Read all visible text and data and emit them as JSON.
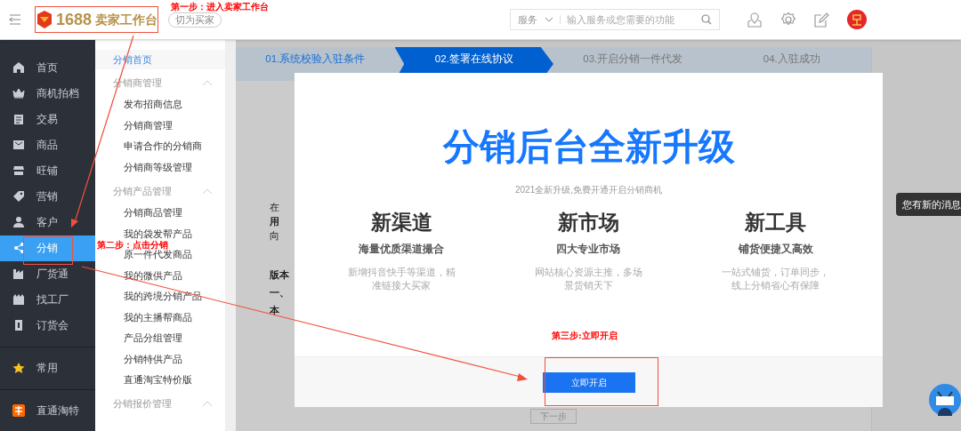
{
  "header": {
    "brand_number": "1688",
    "brand_name": "卖家工作台",
    "switch_button": "切为买家",
    "search": {
      "scope": "服务",
      "placeholder": "输入服务或您需要的功能"
    }
  },
  "nav": [
    {
      "label": "首页",
      "selected": false
    },
    {
      "label": "商机拍档",
      "selected": false
    },
    {
      "label": "交易",
      "selected": false
    },
    {
      "label": "商品",
      "selected": false
    },
    {
      "label": "旺铺",
      "selected": false
    },
    {
      "label": "营销",
      "selected": false
    },
    {
      "label": "客户",
      "selected": false
    },
    {
      "label": "分销",
      "selected": true
    },
    {
      "label": "厂货通",
      "selected": false
    },
    {
      "label": "找工厂",
      "selected": false
    },
    {
      "label": "订货会",
      "selected": false
    },
    {
      "label": "常用",
      "selected": false,
      "divider_before": true
    },
    {
      "label": "直通淘特",
      "selected": false,
      "divider_before": true
    }
  ],
  "submenu": [
    {
      "kind": "link",
      "label": "分销首页",
      "selected": true
    },
    {
      "kind": "group",
      "label": "分销商管理",
      "expanded": true,
      "children": [
        {
          "label": "发布招商信息"
        },
        {
          "label": "分销商管理"
        },
        {
          "label": "申请合作的分销商"
        },
        {
          "label": "分销商等级管理"
        }
      ]
    },
    {
      "kind": "group",
      "label": "分销产品管理",
      "expanded": true,
      "children": [
        {
          "label": "分销商品管理"
        },
        {
          "label": "我的袋发帮产品"
        },
        {
          "label": "原一件代发商品"
        },
        {
          "label": "我的微供产品"
        },
        {
          "label": "我的跨境分销产品"
        },
        {
          "label": "我的主播帮商品"
        },
        {
          "label": "产品分组管理"
        },
        {
          "label": "分销特供产品"
        },
        {
          "label": "直通淘宝特价版"
        }
      ]
    },
    {
      "kind": "group",
      "label": "分销报价管理",
      "expanded": true
    }
  ],
  "steps": [
    {
      "label": "01.系统校验入驻条件",
      "selected": false,
      "done": true
    },
    {
      "label": "02.签署在线协议",
      "selected": true,
      "done": false
    },
    {
      "label": "03.开启分销一件代发",
      "selected": false,
      "done": false
    },
    {
      "label": "04.入驻成功",
      "selected": false,
      "done": false
    }
  ],
  "background_text": [
    {
      "text": "在",
      "bold": false
    },
    {
      "text": "用",
      "bold": true
    },
    {
      "text": "向",
      "bold": false
    },
    {
      "text": "版本",
      "bold": true
    },
    {
      "text": "一、",
      "bold": true
    },
    {
      "text": "本",
      "bold": true
    }
  ],
  "next_button": "下一步",
  "modal": {
    "title": "分销后台全新升级",
    "subtitle": "2021全新升级,免费开通开启分销商机",
    "features": [
      {
        "title": "新渠道",
        "subtitle": "海量优质渠道撮合",
        "description": "新增抖音快手等渠道，精准链接大买家"
      },
      {
        "title": "新市场",
        "subtitle": "四大专业市场",
        "description": "网站核心资源主推，多场景货销天下"
      },
      {
        "title": "新工具",
        "subtitle": "铺货便捷又高效",
        "description": "一站式铺货，订单同步，线上分销省心有保障"
      }
    ],
    "button": "立即开启"
  },
  "message_tip": "您有新的消息",
  "annotations": [
    {
      "text": "第一步：进入卖家工作台"
    },
    {
      "text": "第二步：点击分销"
    },
    {
      "text": "第三步:立即开启"
    }
  ]
}
